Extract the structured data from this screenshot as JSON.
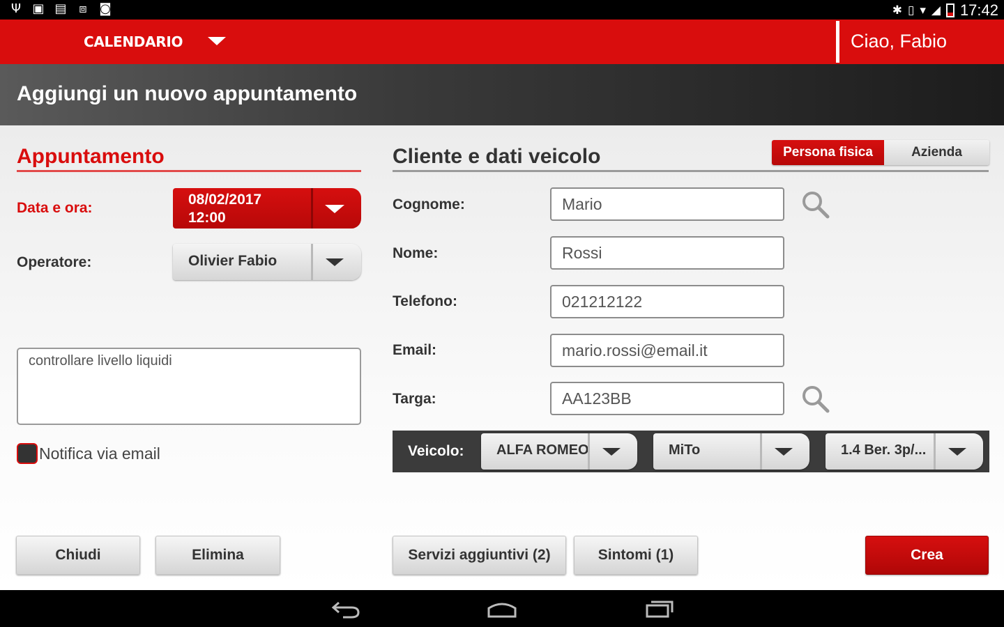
{
  "status_bar": {
    "time": "17:42"
  },
  "header": {
    "nav_title": "CALENDARIO",
    "greeting": "Ciao,  Fabio"
  },
  "page_title": "Aggiungi un nuovo appuntamento",
  "appointment": {
    "section_title": "Appuntamento",
    "date_label": "Data e ora:",
    "date_value": "08/02/2017",
    "time_value": "12:00",
    "operator_label": "Operatore:",
    "operator_value": "Olivier Fabio",
    "notes": "controllare livello liquidi",
    "notify_label": "Notifica via email",
    "notify_checked": false
  },
  "client": {
    "section_title": "Cliente e dati veicolo",
    "toggle": {
      "options": [
        "Persona fisica",
        "Azienda"
      ],
      "selected": "Persona fisica"
    },
    "fields": {
      "cognome": {
        "label": "Cognome:",
        "value": "Mario"
      },
      "nome": {
        "label": "Nome:",
        "value": "Rossi"
      },
      "telefono": {
        "label": "Telefono:",
        "value": "021212122"
      },
      "email": {
        "label": "Email:",
        "value": "mario.rossi@email.it"
      },
      "targa": {
        "label": "Targa:",
        "value": "AA123BB"
      }
    },
    "vehicle": {
      "label": "Veicolo:",
      "brand": "ALFA ROMEO",
      "model": "MiTo",
      "version": "1.4 Ber. 3p/..."
    }
  },
  "buttons": {
    "close": "Chiudi",
    "delete": "Elimina",
    "extra_services": "Servizi aggiuntivi (2)",
    "symptoms": "Sintomi (1)",
    "create": "Crea"
  },
  "colors": {
    "brand_red": "#d90d0d",
    "dark_band": "#1c1c1c"
  },
  "icons": [
    "usb-icon",
    "image-icon",
    "file-icon",
    "briefcase-icon",
    "camera-icon",
    "bluetooth-icon",
    "vibrate-icon",
    "wifi-icon",
    "signal-icon",
    "battery-icon",
    "search-icon",
    "back-icon",
    "home-icon",
    "recents-icon"
  ]
}
